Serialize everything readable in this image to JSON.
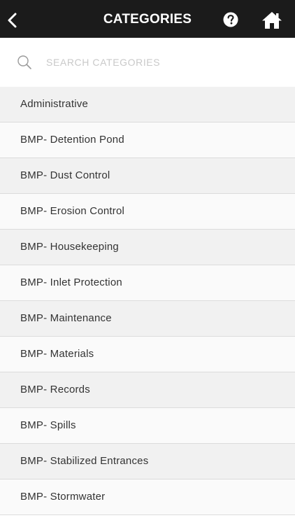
{
  "header": {
    "title": "CATEGORIES",
    "back_icon": "chevron-left-icon",
    "help_icon": "question-circle-icon",
    "home_icon": "home-icon",
    "background": "#1b1b1b"
  },
  "search": {
    "placeholder": "SEARCH CATEGORIES",
    "value": "",
    "icon": "search-icon"
  },
  "categories": [
    "Administrative",
    "BMP- Detention Pond",
    "BMP- Dust Control",
    "BMP- Erosion Control",
    "BMP- Housekeeping",
    "BMP- Inlet Protection",
    "BMP- Maintenance",
    "BMP- Materials",
    "BMP- Records",
    "BMP- Spills",
    "BMP- Stabilized Entrances",
    "BMP- Stormwater"
  ]
}
